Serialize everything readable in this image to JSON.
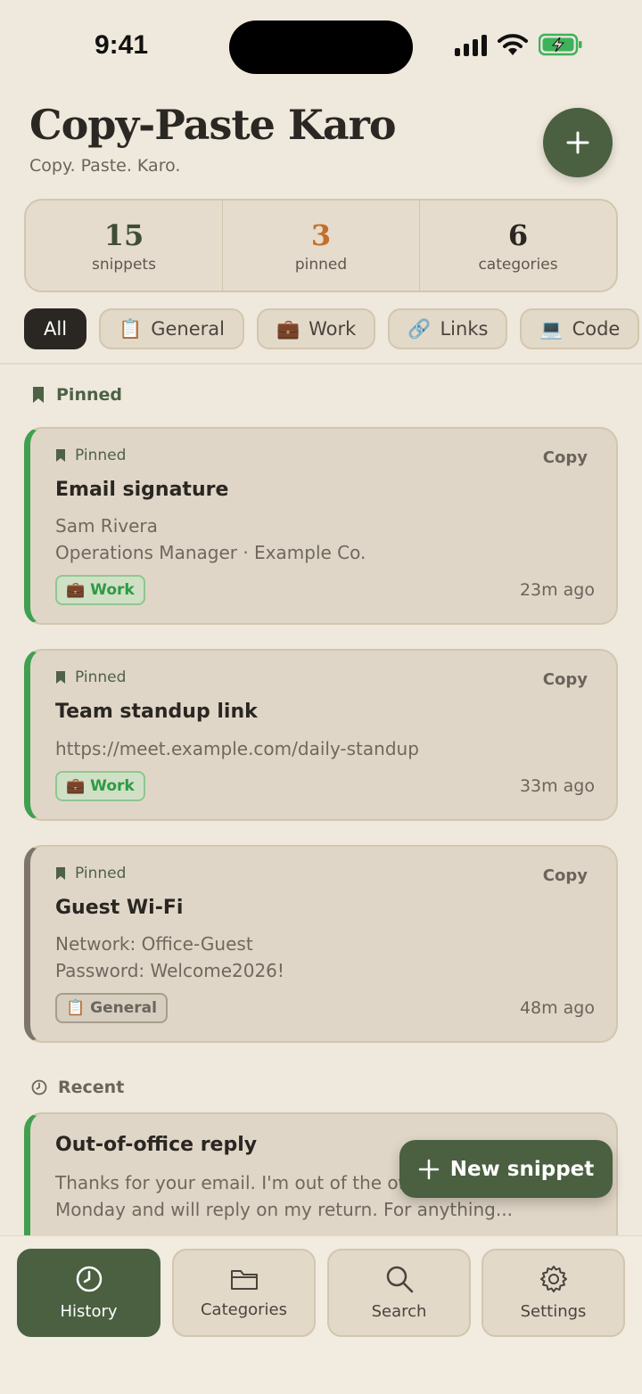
{
  "status_bar": {
    "time": "9:41"
  },
  "header": {
    "title": "Copy-Paste Karo",
    "subtitle": "Copy. Paste. Karo.",
    "add_icon": "plus-icon"
  },
  "stats": [
    {
      "value": "15",
      "label": "snippets"
    },
    {
      "value": "3",
      "label": "pinned"
    },
    {
      "value": "6",
      "label": "categories"
    }
  ],
  "filters": [
    {
      "label": "All",
      "icon": ""
    },
    {
      "label": "General",
      "icon": "📋"
    },
    {
      "label": "Work",
      "icon": "💼"
    },
    {
      "label": "Links",
      "icon": "🔗"
    },
    {
      "label": "Code",
      "icon": "💻"
    }
  ],
  "sections": {
    "pinned": "Pinned",
    "recent": "Recent"
  },
  "cards": [
    {
      "pin_label": "Pinned",
      "copy": "Copy",
      "title": "Email signature",
      "body": [
        "Sam Rivera",
        "Operations Manager · Example Co."
      ],
      "tag": "Work",
      "tag_icon": "💼",
      "ago": "23m ago"
    },
    {
      "pin_label": "Pinned",
      "copy": "Copy",
      "title": "Team standup link",
      "body": [
        "https://meet.example.com/daily-standup"
      ],
      "tag": "Work",
      "tag_icon": "💼",
      "ago": "33m ago"
    },
    {
      "pin_label": "Pinned",
      "copy": "Copy",
      "title": "Guest Wi-Fi",
      "body": [
        "Network: Office-Guest",
        "Password: Welcome2026!"
      ],
      "tag": "General",
      "tag_icon": "📋",
      "ago": "48m ago"
    },
    {
      "title": "Out-of-office reply",
      "body": [
        "Thanks for your email. I'm out of the of",
        "Monday and will reply on my return. For anything..."
      ]
    }
  ],
  "fab": {
    "label": "New snippet"
  },
  "nav": [
    {
      "label": "History",
      "icon": "clock-icon"
    },
    {
      "label": "Categories",
      "icon": "folder-icon"
    },
    {
      "label": "Search",
      "icon": "search-icon"
    },
    {
      "label": "Settings",
      "icon": "gear-icon"
    }
  ],
  "colors": {
    "accent": "#4a6040",
    "background": "#efe8dc",
    "work": "#2e9a44",
    "pinned_count": "#c0702a"
  }
}
